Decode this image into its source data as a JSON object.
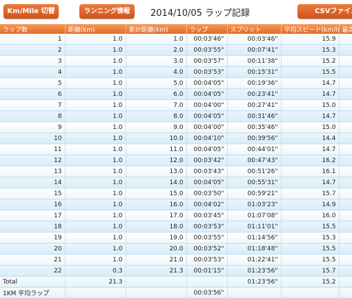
{
  "toolbar": {
    "km_mile_label": "Km/Mile 切替",
    "running_info_label": "ランニング情報",
    "title": "2014/10/05 ラップ記録",
    "csv_label": "CSVファイルを"
  },
  "columns": [
    "ラップ数",
    "距離(km)",
    "累計距離(km)",
    "ラップ",
    "スプリット",
    "平均スピード(km/h)",
    "最高"
  ],
  "rows": [
    {
      "lap": "1",
      "dist": "1.0",
      "cum": "1.0",
      "laptime": "00:03'46\"",
      "split": "00:03'46\"",
      "speed": "15.9"
    },
    {
      "lap": "2",
      "dist": "1.0",
      "cum": "2.0",
      "laptime": "00:03'55\"",
      "split": "00:07'41\"",
      "speed": "15.3"
    },
    {
      "lap": "3",
      "dist": "1.0",
      "cum": "3.0",
      "laptime": "00:03'57\"",
      "split": "00:11'38\"",
      "speed": "15.2"
    },
    {
      "lap": "4",
      "dist": "1.0",
      "cum": "4.0",
      "laptime": "00:03'53\"",
      "split": "00:15'31\"",
      "speed": "15.5"
    },
    {
      "lap": "5",
      "dist": "1.0",
      "cum": "5.0",
      "laptime": "00:04'05\"",
      "split": "00:19'36\"",
      "speed": "14.7"
    },
    {
      "lap": "6",
      "dist": "1.0",
      "cum": "6.0",
      "laptime": "00:04'05\"",
      "split": "00:23'41\"",
      "speed": "14.7"
    },
    {
      "lap": "7",
      "dist": "1.0",
      "cum": "7.0",
      "laptime": "00:04'00\"",
      "split": "00:27'41\"",
      "speed": "15.0"
    },
    {
      "lap": "8",
      "dist": "1.0",
      "cum": "8.0",
      "laptime": "00:04'05\"",
      "split": "00:31'46\"",
      "speed": "14.7"
    },
    {
      "lap": "9",
      "dist": "1.0",
      "cum": "9.0",
      "laptime": "00:04'00\"",
      "split": "00:35'46\"",
      "speed": "15.0"
    },
    {
      "lap": "10",
      "dist": "1.0",
      "cum": "10.0",
      "laptime": "00:04'10\"",
      "split": "00:39'56\"",
      "speed": "14.4"
    },
    {
      "lap": "11",
      "dist": "1.0",
      "cum": "11.0",
      "laptime": "00:04'05\"",
      "split": "00:44'01\"",
      "speed": "14.7"
    },
    {
      "lap": "12",
      "dist": "1.0",
      "cum": "12.0",
      "laptime": "00:03'42\"",
      "split": "00:47'43\"",
      "speed": "16.2"
    },
    {
      "lap": "13",
      "dist": "1.0",
      "cum": "13.0",
      "laptime": "00:03'43\"",
      "split": "00:51'26\"",
      "speed": "16.1"
    },
    {
      "lap": "14",
      "dist": "1.0",
      "cum": "14.0",
      "laptime": "00:04'05\"",
      "split": "00:55'31\"",
      "speed": "14.7"
    },
    {
      "lap": "15",
      "dist": "1.0",
      "cum": "15.0",
      "laptime": "00:03'50\"",
      "split": "00:59'21\"",
      "speed": "15.7"
    },
    {
      "lap": "16",
      "dist": "1.0",
      "cum": "16.0",
      "laptime": "00:04'02\"",
      "split": "01:03'23\"",
      "speed": "14.9"
    },
    {
      "lap": "17",
      "dist": "1.0",
      "cum": "17.0",
      "laptime": "00:03'45\"",
      "split": "01:07'08\"",
      "speed": "16.0"
    },
    {
      "lap": "18",
      "dist": "1.0",
      "cum": "18.0",
      "laptime": "00:03'53\"",
      "split": "01:11'01\"",
      "speed": "15.5"
    },
    {
      "lap": "19",
      "dist": "1.0",
      "cum": "19.0",
      "laptime": "00:03'55\"",
      "split": "01:14'56\"",
      "speed": "15.3"
    },
    {
      "lap": "20",
      "dist": "1.0",
      "cum": "20.0",
      "laptime": "00:03'52\"",
      "split": "01:18'48\"",
      "speed": "15.5"
    },
    {
      "lap": "21",
      "dist": "1.0",
      "cum": "21.0",
      "laptime": "00:03'53\"",
      "split": "01:22'41\"",
      "speed": "15.5"
    },
    {
      "lap": "22",
      "dist": "0.3",
      "cum": "21.3",
      "laptime": "00:01'15\"",
      "split": "01:23'56\"",
      "speed": "15.7"
    }
  ],
  "total": {
    "label": "Total",
    "dist": "21.3",
    "cum": "",
    "laptime": "",
    "split": "01:23'56\"",
    "speed": "15.2"
  },
  "avg": {
    "label": "1KM 平均ラップ",
    "laptime": "00:03'56\""
  }
}
